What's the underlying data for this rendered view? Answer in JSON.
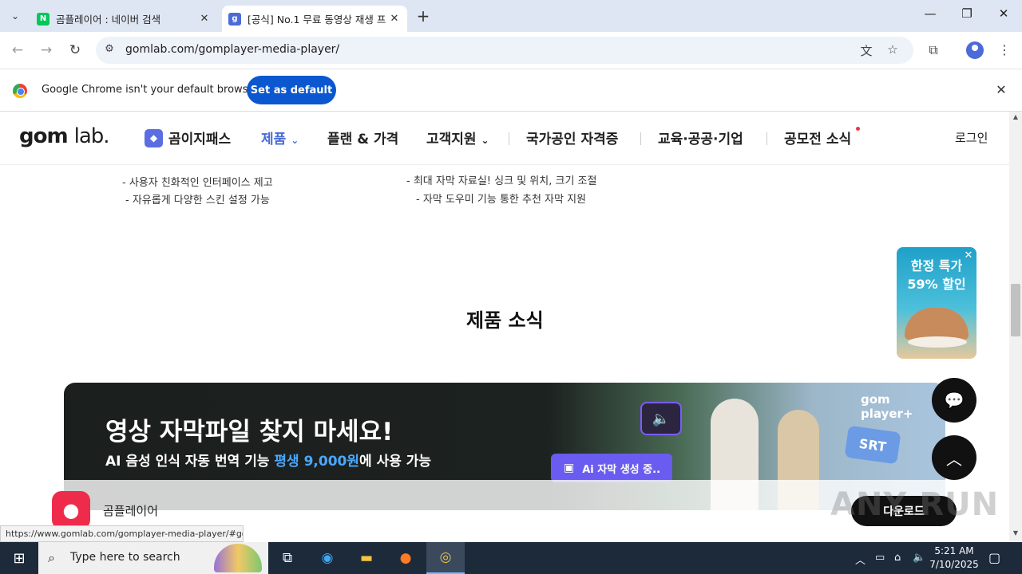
{
  "browser": {
    "tabs": [
      {
        "title": "곰플레이어 : 네이버 검색",
        "favicon": "N",
        "close": "✕"
      },
      {
        "title": "[공식] No.1 무료 동영상 재생 프",
        "favicon": "g",
        "close": "✕"
      }
    ],
    "new_tab": "+",
    "url": "gomlab.com/gomplayer-media-player/",
    "infobar": {
      "message": "Google Chrome isn't your default browser",
      "button": "Set as default",
      "close": "✕"
    },
    "status_url": "https://www.gomlab.com/gomplayer-media-player/#gom"
  },
  "site": {
    "logo_gom": "gom",
    "logo_lab": "lab.",
    "nav": {
      "gompass": "곰이지패스",
      "products": "제품",
      "plans": "플랜 & 가격",
      "support": "고객지원",
      "certification": "국가공인 자격증",
      "education": "교육·공공·기업",
      "contest": "공모전 소식",
      "login": "로그인"
    },
    "features_left": [
      "- 사용자 친화적인 인터페이스 제고",
      "- 자유롭게 다양한 스킨 설정 가능"
    ],
    "features_right": [
      "- 최대 자막 자료실! 싱크 및 위치, 크기 조절",
      "- 자막 도우미 기능 통한 추천 자막 지원"
    ],
    "section_title": "제품 소식",
    "promo": {
      "line1": "한정 특가",
      "line2": "59% 할인"
    },
    "banner": {
      "headline": "영상 자막파일 찾지 마세요!",
      "sub_before": "AI 음성 인식 자동 번역 기능 ",
      "sub_highlight": "평생 9,000원",
      "sub_after": "에 사용 가능",
      "brand": "gom player+",
      "ai_button": "Ai 자막 생성 중..",
      "srt": "SRT"
    },
    "download_bar": {
      "app_name": "곰플레이어",
      "button": "다운로드"
    },
    "watermark": "ANY RUN"
  },
  "taskbar": {
    "search_placeholder": "Type here to search",
    "time": "5:21 AM",
    "date": "7/10/2025"
  },
  "colors": {
    "accent": "#4a6bd8",
    "chrome_button": "#0b57d0",
    "highlight": "#4aa8ff",
    "ai_button": "#6a5cf0",
    "app_icon": "#ef2b4b"
  }
}
